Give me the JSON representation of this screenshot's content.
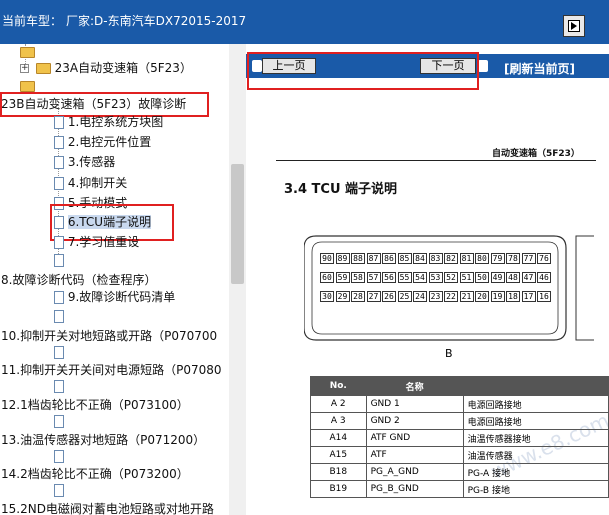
{
  "header": {
    "car_label": "当前车型：",
    "car_value": "厂家:D-东南汽车DX72015-2017",
    "corner_icon": "panel-toggle-icon"
  },
  "tree": {
    "items": [
      {
        "label": "23A自动变速箱（5F23）",
        "icon": "folder-icon",
        "expander": "+"
      },
      {
        "label": "23B自动变速箱（5F23）故障诊断",
        "icon": "none"
      },
      {
        "label": "1.电控系统方块图",
        "icon": "document-icon"
      },
      {
        "label": "2.电控元件位置",
        "icon": "document-icon"
      },
      {
        "label": "3.传感器",
        "icon": "document-icon"
      },
      {
        "label": "4.抑制开关",
        "icon": "document-icon"
      },
      {
        "label": "5.手动模式",
        "icon": "document-icon"
      },
      {
        "label": "6.TCU端子说明",
        "icon": "document-icon",
        "selected": true
      },
      {
        "label": "7.学习值重设",
        "icon": "document-icon"
      },
      {
        "label": "8.故障诊断代码（检查程序）",
        "icon": "document-icon"
      },
      {
        "label": "9.故障诊断代码清单",
        "icon": "document-icon"
      },
      {
        "label": "10.抑制开关对地短路或开路（P070700",
        "icon": "document-icon"
      },
      {
        "label": "11.抑制开关开关间对电源短路（P07080",
        "icon": "document-icon"
      },
      {
        "label": "12.1档齿轮比不正确（P073100）",
        "icon": "document-icon"
      },
      {
        "label": "13.油温传感器对地短路（P071200）",
        "icon": "document-icon"
      },
      {
        "label": "14.2档齿轮比不正确（P073200）",
        "icon": "document-icon"
      },
      {
        "label": "15.2ND电磁阀对蓄电池短路或对地开路",
        "icon": "document-icon"
      }
    ],
    "highlight_color": "#e02020"
  },
  "nav": {
    "prev_label": "上一页",
    "next_label": "下一页",
    "refresh_label": "[刷新当前页]"
  },
  "document": {
    "header_text": "自动变速箱（5F23）",
    "section_title": "3.4   TCU 端子说明",
    "connector_label": "B",
    "connector_rows": [
      [
        "90",
        "89",
        "88",
        "87",
        "86",
        "85",
        "84",
        "83",
        "82",
        "81",
        "80",
        "79",
        "78",
        "77",
        "76"
      ],
      [
        "60",
        "59",
        "58",
        "57",
        "56",
        "55",
        "54",
        "53",
        "52",
        "51",
        "50",
        "49",
        "48",
        "47",
        "46"
      ],
      [
        "30",
        "29",
        "28",
        "27",
        "26",
        "25",
        "24",
        "23",
        "22",
        "21",
        "20",
        "19",
        "18",
        "17",
        "16"
      ]
    ],
    "table_headers": [
      "No.",
      "名称",
      ""
    ],
    "table_rows": [
      {
        "no": "A 2",
        "name": "GND 1",
        "desc": "电源回路接地"
      },
      {
        "no": "A 3",
        "name": "GND 2",
        "desc": "电源回路接地"
      },
      {
        "no": "A14",
        "name": "ATF GND",
        "desc": "油温传感器接地"
      },
      {
        "no": "A15",
        "name": "ATF",
        "desc": "油温传感器"
      },
      {
        "no": "B18",
        "name": "PG_A_GND",
        "desc": "PG-A 接地"
      },
      {
        "no": "B19",
        "name": "PG_B_GND",
        "desc": "PG-B 接地"
      }
    ]
  },
  "colors": {
    "header_bg": "#1a5aa8",
    "navbar_bg": "#1a5aa8"
  }
}
